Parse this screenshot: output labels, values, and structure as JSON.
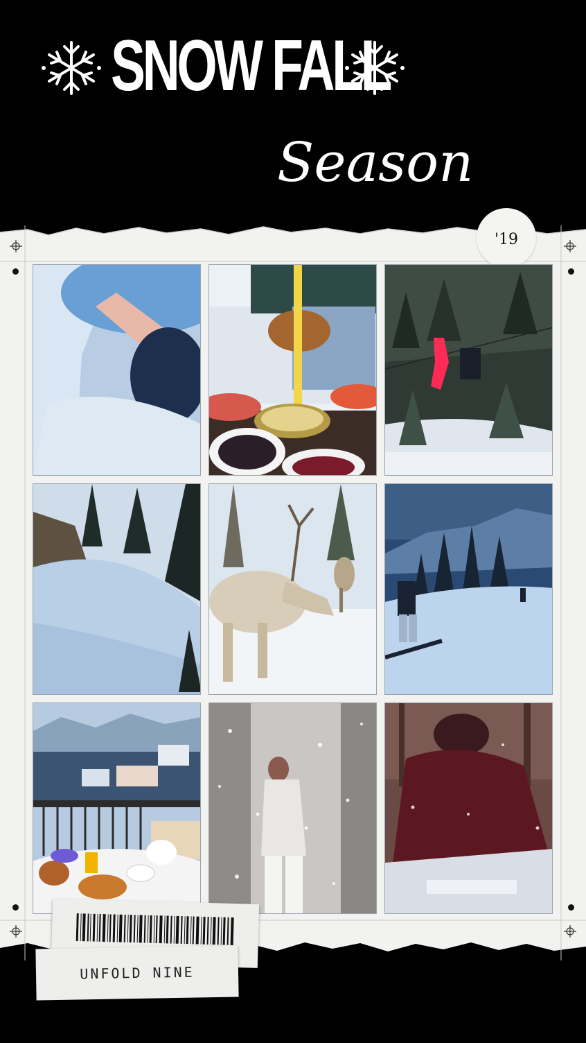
{
  "header": {
    "title": "SNOW FALL",
    "subtitle": "Season"
  },
  "badge": {
    "year": "'19"
  },
  "footer": {
    "label": "UNFOLD NINE"
  },
  "colors": {
    "background": "#000000",
    "paper": "#f2f2f0",
    "text": "#ffffff",
    "jacket_red": "#ff2a55",
    "snow_blue": "#b9cfe6"
  },
  "icons": {
    "left_flake": "snowflake-icon",
    "right_flake": "snowflake-icon",
    "registration": "crosshair-icon",
    "barcode": "barcode-icon"
  },
  "photos": [
    {
      "name": "snow-wall-hand-photo"
    },
    {
      "name": "breakfast-pour-photo"
    },
    {
      "name": "zipline-forest-photo"
    },
    {
      "name": "snowy-slope-photo"
    },
    {
      "name": "reindeer-photo"
    },
    {
      "name": "snowboarder-photo"
    },
    {
      "name": "balcony-breakfast-photo"
    },
    {
      "name": "snowfall-forest-photo"
    },
    {
      "name": "red-jacket-snow-photo"
    }
  ]
}
